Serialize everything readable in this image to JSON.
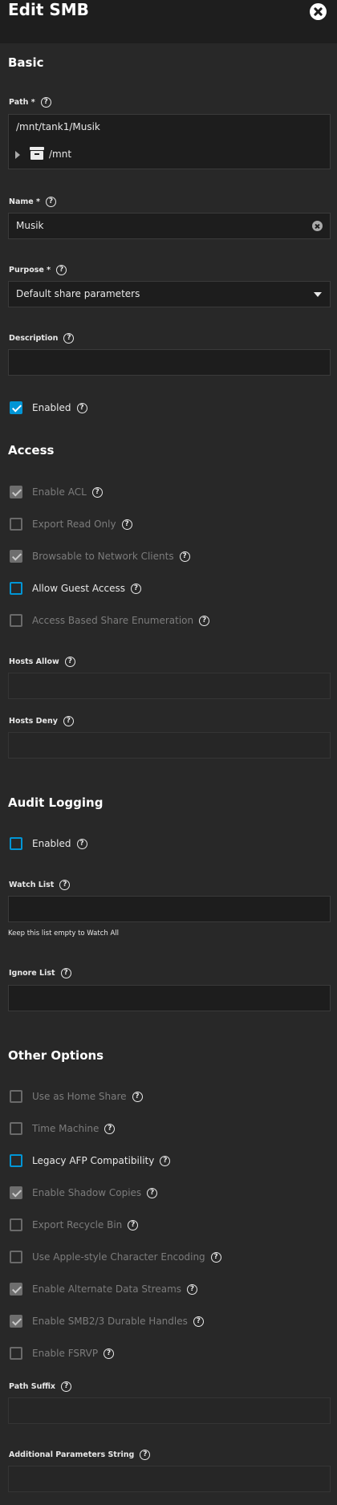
{
  "header": {
    "title": "Edit SMB",
    "close": "close"
  },
  "help_glyph": "?",
  "basic": {
    "title": "Basic",
    "path": {
      "label": "Path *",
      "value": "/mnt/tank1/Musik",
      "tree_root": "/mnt"
    },
    "name": {
      "label": "Name *",
      "value": "Musik"
    },
    "purpose": {
      "label": "Purpose *",
      "value": "Default share parameters"
    },
    "description": {
      "label": "Description",
      "value": ""
    },
    "enabled": {
      "label": "Enabled",
      "checked": true
    }
  },
  "access": {
    "title": "Access",
    "options": [
      {
        "label": "Enable ACL",
        "checked": true,
        "disabled": true
      },
      {
        "label": "Export Read Only",
        "checked": false,
        "disabled": true
      },
      {
        "label": "Browsable to Network Clients",
        "checked": true,
        "disabled": true
      },
      {
        "label": "Allow Guest Access",
        "checked": false,
        "disabled": false
      },
      {
        "label": "Access Based Share Enumeration",
        "checked": false,
        "disabled": true
      }
    ],
    "hosts_allow": {
      "label": "Hosts Allow",
      "value": ""
    },
    "hosts_deny": {
      "label": "Hosts Deny",
      "value": ""
    }
  },
  "audit_logging": {
    "title": "Audit Logging",
    "enabled": {
      "label": "Enabled",
      "checked": false
    },
    "watch_list": {
      "label": "Watch List",
      "hint": "Keep this list empty to Watch All"
    },
    "ignore_list": {
      "label": "Ignore List"
    }
  },
  "other_options": {
    "title": "Other Options",
    "options": [
      {
        "label": "Use as Home Share",
        "checked": false,
        "disabled": true
      },
      {
        "label": "Time Machine",
        "checked": false,
        "disabled": true
      },
      {
        "label": "Legacy AFP Compatibility",
        "checked": false,
        "disabled": false
      },
      {
        "label": "Enable Shadow Copies",
        "checked": true,
        "disabled": true
      },
      {
        "label": "Export Recycle Bin",
        "checked": false,
        "disabled": true
      },
      {
        "label": "Use Apple-style Character Encoding",
        "checked": false,
        "disabled": true
      },
      {
        "label": "Enable Alternate Data Streams",
        "checked": true,
        "disabled": true
      },
      {
        "label": "Enable SMB2/3 Durable Handles",
        "checked": true,
        "disabled": true
      },
      {
        "label": "Enable FSRVP",
        "checked": false,
        "disabled": true
      }
    ],
    "path_suffix": {
      "label": "Path Suffix",
      "value": ""
    },
    "additional_parameters": {
      "label": "Additional Parameters String",
      "value": ""
    }
  },
  "colors": {
    "accent": "#0095d5",
    "background": "#282828",
    "header": "#1e1e1e",
    "field": "#1d1d1d"
  }
}
